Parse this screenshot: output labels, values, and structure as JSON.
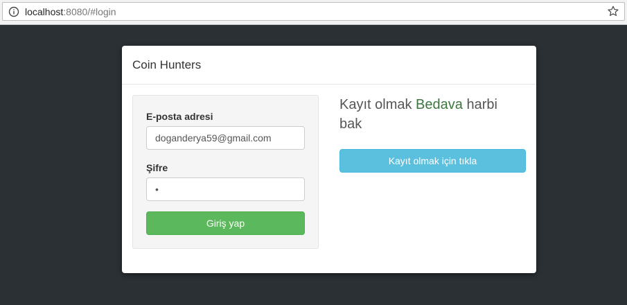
{
  "browser": {
    "url_host": "localhost",
    "url_rest": ":8080/#login"
  },
  "panel": {
    "title": "Coin Hunters"
  },
  "login": {
    "email_label": "E-posta adresi",
    "email_value": "doganderya59@gmail.com",
    "password_label": "Şifre",
    "password_value": "x",
    "submit_label": "Giriş yap"
  },
  "signup": {
    "heading_prefix": "Kayıt olmak ",
    "heading_highlight": "Bedava",
    "heading_suffix": " harbi bak",
    "button_label": "Kayıt olmak için tıkla"
  }
}
